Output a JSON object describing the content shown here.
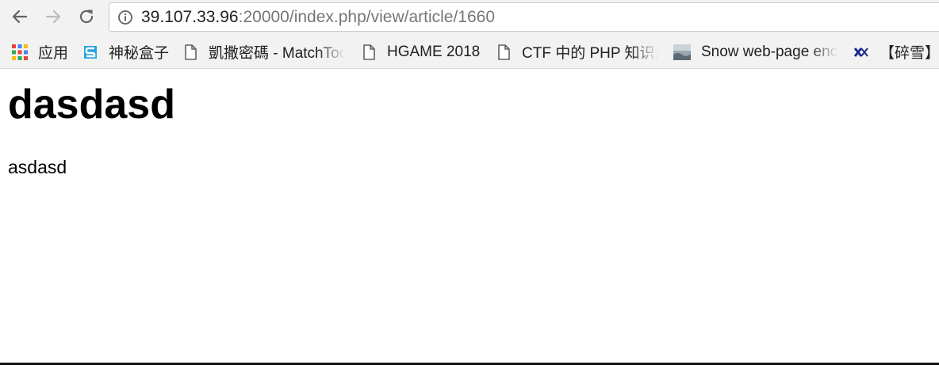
{
  "address_bar": {
    "host": "39.107.33.96",
    "path": ":20000/index.php/view/article/1660"
  },
  "bookmarks": [
    {
      "label": "应用",
      "icon": "apps-grid-icon"
    },
    {
      "label": "神秘盒子",
      "icon": "s-logo-icon"
    },
    {
      "label": "凱撒密碼 - MatchTool",
      "icon": "page-icon"
    },
    {
      "label": "HGAME 2018",
      "icon": "page-icon"
    },
    {
      "label": "CTF 中的 PHP 知识汇总",
      "icon": "page-icon"
    },
    {
      "label": "Snow web-page encoder",
      "icon": "snow-thumbnail-icon"
    },
    {
      "label": "【碎雪】",
      "icon": "x-logo-icon"
    }
  ],
  "article": {
    "title": "dasdasd",
    "body": "asdasd"
  },
  "colors": {
    "toolbar_bg": "#f2f2f2",
    "url_host": "#202124",
    "url_path": "#767676"
  }
}
